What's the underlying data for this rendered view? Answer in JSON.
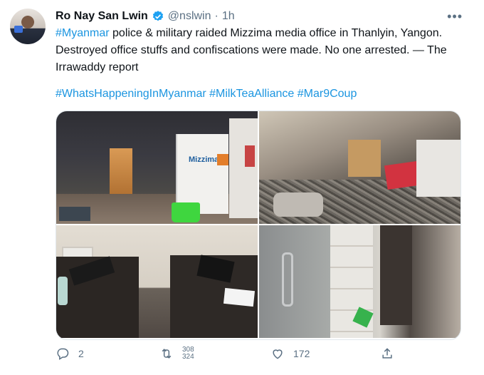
{
  "author": {
    "name": "Ro Nay San Lwin",
    "handle": "@nslwin",
    "separator": "·",
    "time": "1h"
  },
  "tweet": {
    "tag_myanmar": "#Myanmar",
    "text_rest": " police & military raided Mizzima media office in Thanlyin, Yangon. Destroyed office stuffs and confiscations were made. No one arrested. — The Irrawaddy report",
    "hashtags": [
      "#WhatsHappeningInMyanmar",
      "#MilkTeaAlliance",
      "#Mar9Coup"
    ]
  },
  "media": {
    "banner_logo_text": "Mizzima"
  },
  "actions": {
    "reply_count": "2",
    "retweet_count_top": "308",
    "retweet_count_bottom": "324",
    "like_count": "172"
  },
  "icons": {
    "more": "more-dots-icon",
    "verified": "verified-badge-icon",
    "reply": "reply-icon",
    "retweet": "retweet-icon",
    "like": "heart-icon",
    "share": "share-icon"
  },
  "colors": {
    "link": "#1b95e0",
    "verified": "#1da1f2",
    "muted": "#5b7083"
  }
}
